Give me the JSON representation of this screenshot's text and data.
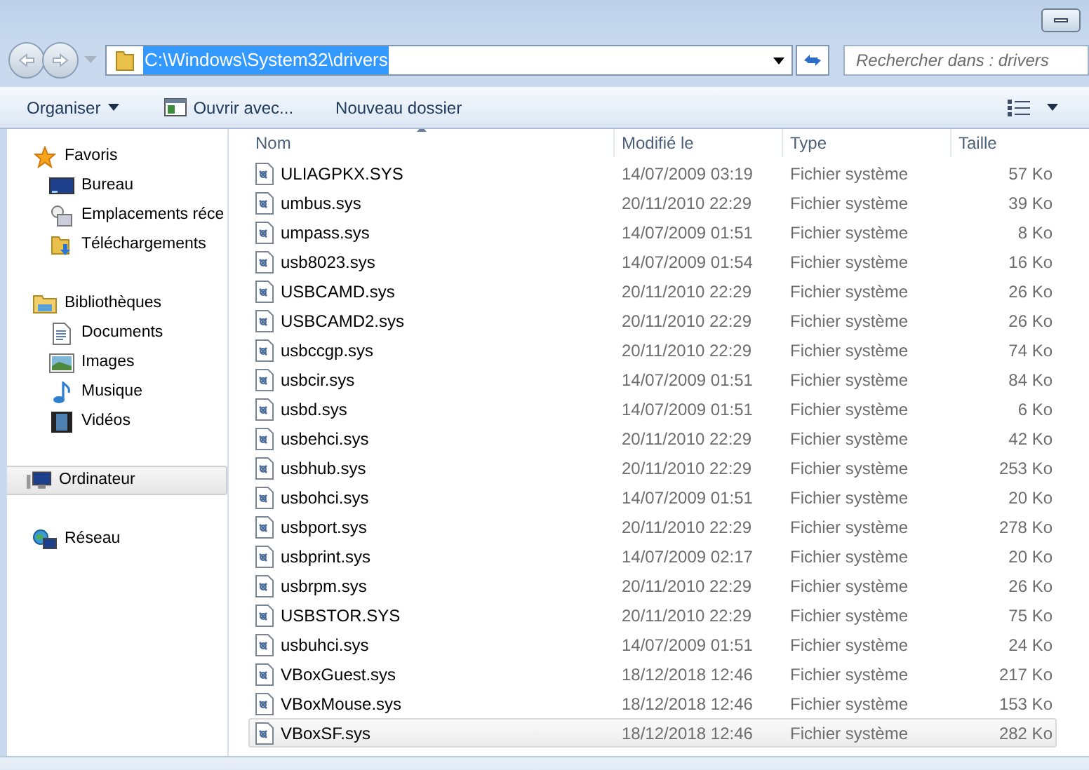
{
  "address_bar": {
    "path": "C:\\Windows\\System32\\drivers"
  },
  "search": {
    "placeholder": "Rechercher dans : drivers"
  },
  "toolbar": {
    "buttons": [
      {
        "label": "Organiser",
        "kind": "menu"
      },
      {
        "label": "Ouvrir avec...",
        "kind": "app"
      },
      {
        "label": "Nouveau dossier",
        "kind": "plain"
      }
    ]
  },
  "sidebar": {
    "groups": [
      {
        "label": "Favoris",
        "kind": "star",
        "selected": false,
        "children": [
          {
            "label": "Bureau",
            "kind": "desktop"
          },
          {
            "label": "Emplacements réce",
            "kind": "recent"
          },
          {
            "label": "Téléchargements",
            "kind": "download"
          }
        ]
      },
      {
        "label": "Bibliothèques",
        "kind": "library",
        "selected": false,
        "children": [
          {
            "label": "Documents",
            "kind": "document"
          },
          {
            "label": "Images",
            "kind": "image"
          },
          {
            "label": "Musique",
            "kind": "music"
          },
          {
            "label": "Vidéos",
            "kind": "video"
          }
        ]
      },
      {
        "label": "Ordinateur",
        "kind": "computer",
        "selected": true
      },
      {
        "label": "Réseau",
        "kind": "network",
        "selected": false
      }
    ]
  },
  "table": {
    "columns": [
      "Nom",
      "Modifié le",
      "Type",
      "Taille"
    ],
    "rows": [
      {
        "name": "ULIAGPKX.SYS",
        "modified": "14/07/2009 03:19",
        "type": "Fichier système",
        "size": "57 Ko",
        "selected": false
      },
      {
        "name": "umbus.sys",
        "modified": "20/11/2010 22:29",
        "type": "Fichier système",
        "size": "39 Ko",
        "selected": false
      },
      {
        "name": "umpass.sys",
        "modified": "14/07/2009 01:51",
        "type": "Fichier système",
        "size": "8 Ko",
        "selected": false
      },
      {
        "name": "usb8023.sys",
        "modified": "14/07/2009 01:54",
        "type": "Fichier système",
        "size": "16 Ko",
        "selected": false
      },
      {
        "name": "USBCAMD.sys",
        "modified": "20/11/2010 22:29",
        "type": "Fichier système",
        "size": "26 Ko",
        "selected": false
      },
      {
        "name": "USBCAMD2.sys",
        "modified": "20/11/2010 22:29",
        "type": "Fichier système",
        "size": "26 Ko",
        "selected": false
      },
      {
        "name": "usbccgp.sys",
        "modified": "20/11/2010 22:29",
        "type": "Fichier système",
        "size": "74 Ko",
        "selected": false
      },
      {
        "name": "usbcir.sys",
        "modified": "14/07/2009 01:51",
        "type": "Fichier système",
        "size": "84 Ko",
        "selected": false
      },
      {
        "name": "usbd.sys",
        "modified": "14/07/2009 01:51",
        "type": "Fichier système",
        "size": "6 Ko",
        "selected": false
      },
      {
        "name": "usbehci.sys",
        "modified": "20/11/2010 22:29",
        "type": "Fichier système",
        "size": "42 Ko",
        "selected": false
      },
      {
        "name": "usbhub.sys",
        "modified": "20/11/2010 22:29",
        "type": "Fichier système",
        "size": "253 Ko",
        "selected": false
      },
      {
        "name": "usbohci.sys",
        "modified": "14/07/2009 01:51",
        "type": "Fichier système",
        "size": "20 Ko",
        "selected": false
      },
      {
        "name": "usbport.sys",
        "modified": "20/11/2010 22:29",
        "type": "Fichier système",
        "size": "278 Ko",
        "selected": false
      },
      {
        "name": "usbprint.sys",
        "modified": "14/07/2009 02:17",
        "type": "Fichier système",
        "size": "20 Ko",
        "selected": false
      },
      {
        "name": "usbrpm.sys",
        "modified": "20/11/2010 22:29",
        "type": "Fichier système",
        "size": "26 Ko",
        "selected": false
      },
      {
        "name": "USBSTOR.SYS",
        "modified": "20/11/2010 22:29",
        "type": "Fichier système",
        "size": "75 Ko",
        "selected": false
      },
      {
        "name": "usbuhci.sys",
        "modified": "14/07/2009 01:51",
        "type": "Fichier système",
        "size": "24 Ko",
        "selected": false
      },
      {
        "name": "VBoxGuest.sys",
        "modified": "18/12/2018 12:46",
        "type": "Fichier système",
        "size": "217 Ko",
        "selected": false
      },
      {
        "name": "VBoxMouse.sys",
        "modified": "18/12/2018 12:46",
        "type": "Fichier système",
        "size": "153 Ko",
        "selected": false
      },
      {
        "name": "VBoxSF.sys",
        "modified": "18/12/2018 12:46",
        "type": "Fichier système",
        "size": "282 Ko",
        "selected": true
      }
    ]
  }
}
